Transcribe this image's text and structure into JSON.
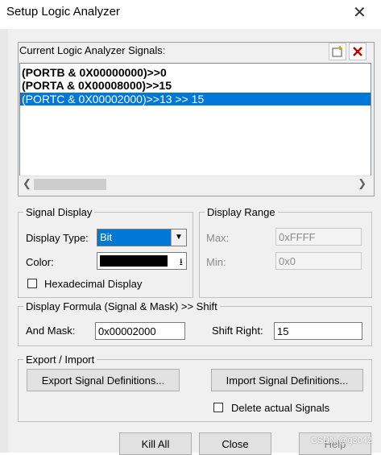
{
  "window": {
    "title": "Setup Logic Analyzer",
    "close_glyph": "✕"
  },
  "signals": {
    "label": "Current Logic Analyzer Signals:",
    "items": [
      "(PORTB & 0X00000000)>>0",
      "(PORTA & 0X00008000)>>15",
      "(PORTC & 0X00002000)>>13 >> 15"
    ],
    "selected_index": 2,
    "new_icon": "new-item-icon",
    "delete_icon": "delete-x-icon",
    "delete_color": "#c00000"
  },
  "signal_display": {
    "group_label": "Signal Display",
    "display_type_label": "Display Type:",
    "display_type_value": "Bit",
    "color_label": "Color:",
    "color_value": "#000000",
    "hex_label": "Hexadecimal Display"
  },
  "display_range": {
    "group_label": "Display Range",
    "max_label": "Max:",
    "max_value": "0xFFFF",
    "min_label": "Min:",
    "min_value": "0x0"
  },
  "formula": {
    "group_label": "Display Formula (Signal & Mask) >> Shift",
    "mask_label": "And Mask:",
    "mask_value": "0x00002000",
    "shift_label": "Shift Right:",
    "shift_value": "15"
  },
  "export_import": {
    "group_label": "Export / Import",
    "export_button": "Export Signal Definitions...",
    "import_button": "Import Signal Definitions...",
    "delete_label": "Delete actual Signals"
  },
  "footer": {
    "kill_all": "Kill All",
    "close": "Close",
    "help": "Help",
    "watermark": "CSDN @g3042"
  },
  "theme": {
    "accent": "#0078d7",
    "dialog_bg": "#f0f0f0"
  }
}
